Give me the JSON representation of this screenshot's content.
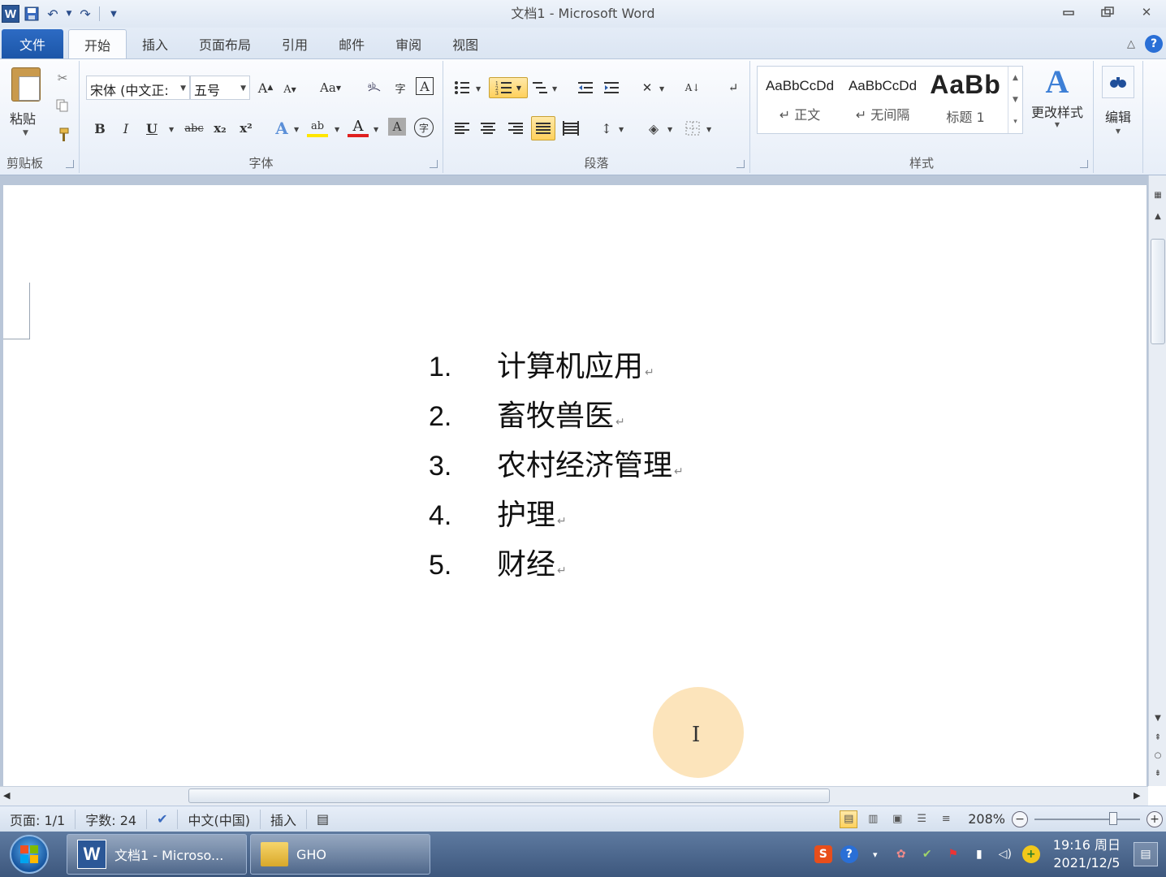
{
  "window": {
    "title": "文档1  -  Microsoft Word",
    "quick_access": [
      "save-icon",
      "undo-icon",
      "redo-icon",
      "customize-icon"
    ]
  },
  "ribbon": {
    "tabs": [
      {
        "label": "文件"
      },
      {
        "label": "开始"
      },
      {
        "label": "插入"
      },
      {
        "label": "页面布局"
      },
      {
        "label": "引用"
      },
      {
        "label": "邮件"
      },
      {
        "label": "审阅"
      },
      {
        "label": "视图"
      }
    ],
    "active_tab": "开始",
    "clipboard": {
      "paste_label": "粘贴",
      "group_label": "剪贴板"
    },
    "font": {
      "font_name": "宋体 (中文正:",
      "font_size": "五号",
      "group_label": "字体",
      "case_label": "Aa",
      "bold": "B",
      "italic": "I",
      "underline": "U",
      "strike": "abc",
      "subscript": "x₂",
      "superscript": "x²",
      "font_color_label": "A",
      "highlight_label": "ab",
      "grow": "A",
      "shrink": "A",
      "char_shading": "A",
      "enclose": "字"
    },
    "paragraph": {
      "group_label": "段落"
    },
    "styles": {
      "items": [
        {
          "sample": "AaBbCcDd",
          "name": "↵ 正文"
        },
        {
          "sample": "AaBbCcDd",
          "name": "↵ 无间隔"
        },
        {
          "sample": "AaBb",
          "name": "标题 1"
        }
      ],
      "change_styles_label": "更改样式",
      "group_label": "样式"
    },
    "editing": {
      "label": "编辑"
    }
  },
  "document": {
    "list_items": [
      {
        "num": "1.",
        "text": "计算机应用"
      },
      {
        "num": "2.",
        "text": "畜牧兽医"
      },
      {
        "num": "3.",
        "text": "农村经济管理"
      },
      {
        "num": "4.",
        "text": "护理"
      },
      {
        "num": "5.",
        "text": "财经"
      }
    ],
    "paragraph_mark": "↵"
  },
  "statusbar": {
    "page": "页面: 1/1",
    "words": "字数: 24",
    "language": "中文(中国)",
    "mode": "插入",
    "zoom": "208%",
    "zoom_minus": "−",
    "zoom_plus": "+"
  },
  "taskbar": {
    "word_task": "文档1 - Microso...",
    "folder_task": "GHO",
    "time": "19:16 周日",
    "date": "2021/12/5"
  },
  "colors": {
    "accent": "#2b5797",
    "file_tab": "#1c56a8",
    "active_button": "#ffd15c",
    "taskbar": "#3d577d"
  }
}
